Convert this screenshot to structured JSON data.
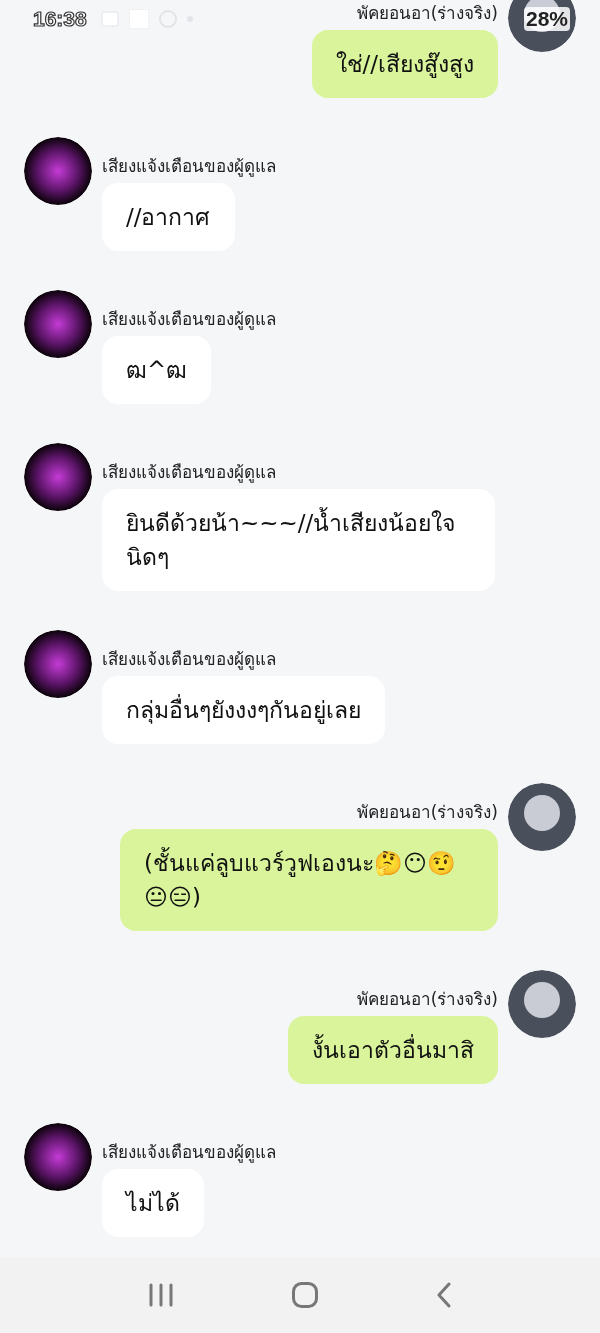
{
  "status_bar": {
    "time": "16:38",
    "battery": "28%"
  },
  "messages": [
    {
      "kind": "outgoing",
      "sender": "พัคยอนอา(ร่างจริง)",
      "text": "ใช่//เสียงสู๊งสูง"
    },
    {
      "kind": "incoming",
      "sender": "เสียงแจ้งเตือนของผู้ดูแล",
      "text": "//อากาศ"
    },
    {
      "kind": "incoming",
      "sender": "เสียงแจ้งเตือนของผู้ดูแล",
      "text": "ฒ^ฒ"
    },
    {
      "kind": "incoming",
      "sender": "เสียงแจ้งเตือนของผู้ดูแล",
      "text": "ยินดีด้วยน้า~~~//น้ำเสียงน้อยใจนิดๆ"
    },
    {
      "kind": "incoming",
      "sender": "เสียงแจ้งเตือนของผู้ดูแล",
      "text": "กลุ่มอื่นๆยังงงๆกันอยู่เลย"
    },
    {
      "kind": "outgoing",
      "sender": "พัคยอนอา(ร่างจริง)",
      "text": "(ชั้นแค่ลูบแวร์วูฟเองนะ🤔😶🤨😐😑)"
    },
    {
      "kind": "outgoing",
      "sender": "พัคยอนอา(ร่างจริง)",
      "text": "งั้นเอาตัวอื่นมาสิ"
    },
    {
      "kind": "incoming",
      "sender": "เสียงแจ้งเตือนของผู้ดูแล",
      "text": "ไม่ได้"
    }
  ]
}
